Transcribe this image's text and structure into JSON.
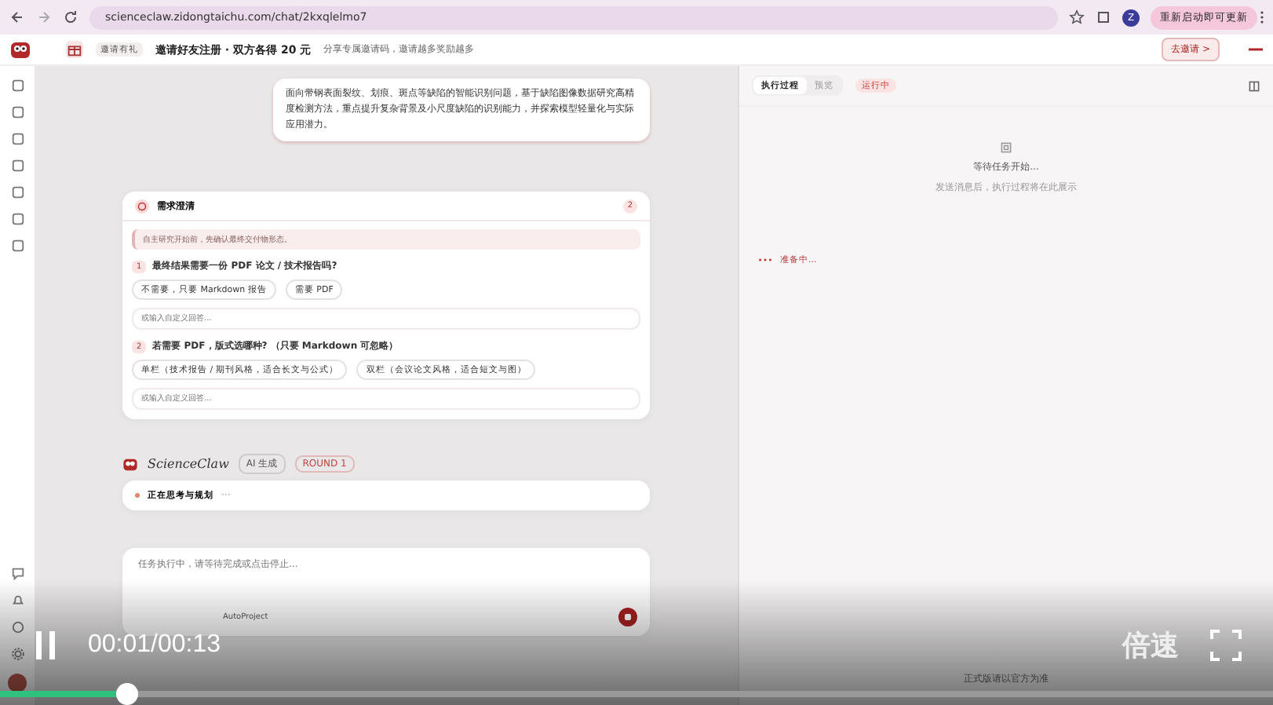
{
  "browser": {
    "url": "scienceclaw.zidongtaichu.com/chat/2kxqlelmo7",
    "profile_initial": "Z",
    "update_button": "重新启动即可更新"
  },
  "promo_bar": {
    "badge": "邀请有礼",
    "headline": "邀请好友注册 · 双方各得 20 元",
    "subtext": "分享专属邀请码，邀请越多奖励越多",
    "button": "去邀请 >"
  },
  "chat": {
    "user_message": "面向带钢表面裂纹、划痕、斑点等缺陷的智能识别问题，基于缺陷图像数据研究高精度检测方法，重点提升复杂背景及小尺度缺陷的识别能力，并探索模型轻量化与实际应用潜力。",
    "clarification": {
      "title": "需求澄清",
      "count": "2",
      "notice": "自主研究开始前，先确认最终交付物形态。",
      "questions": [
        {
          "number": "1",
          "text": "最终结果需要一份 PDF 论文 / 技术报告吗?",
          "options": [
            {
              "label": "不需要，只要 Markdown 报告",
              "selected": false
            },
            {
              "label": "需要 PDF",
              "selected": false
            }
          ],
          "placeholder": "或输入自定义回答..."
        },
        {
          "number": "2",
          "text": "若需要 PDF，版式选哪种? （只要 Markdown 可忽略）",
          "options": [
            {
              "label": "单栏（技术报告 / 期刊风格，适合长文与公式）",
              "selected": false
            },
            {
              "label": "双栏（会议论文风格，适合短文与图）",
              "selected": false
            }
          ],
          "placeholder": "或输入自定义回答..."
        }
      ]
    },
    "assistant": {
      "name": "ScienceClaw",
      "tag": "AI 生成",
      "round": "ROUND 1",
      "status": "正在思考与规划",
      "status_dots": "···"
    },
    "composer": {
      "placeholder": "任务执行中，请等待完成或点击停止...",
      "project": "AutoProject"
    }
  },
  "panel": {
    "tabs": [
      {
        "label": "执行过程",
        "selected": true
      },
      {
        "label": "预览",
        "selected": false
      }
    ],
    "status": "运行中",
    "empty_title": "等待任务开始...",
    "empty_hint": "发送消息后，执行过程将在此展示",
    "log": "准备中...",
    "footer": "正式版请以官方为准"
  },
  "video": {
    "time": "00:01/00:13",
    "speed": "倍速",
    "level": 0.1
  }
}
